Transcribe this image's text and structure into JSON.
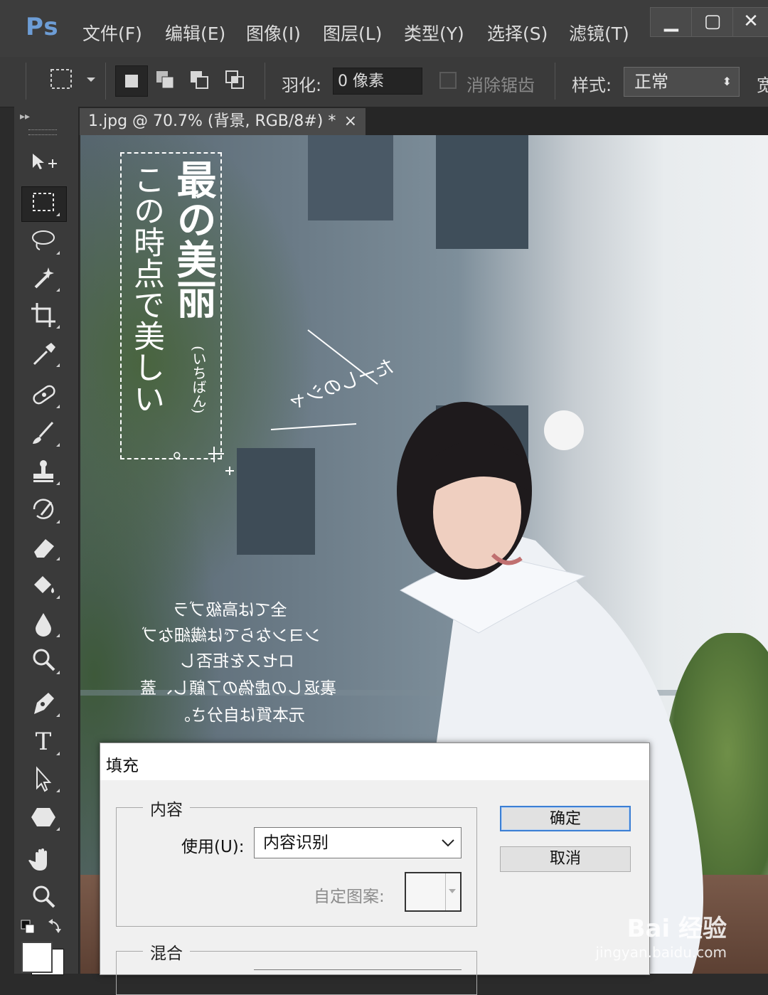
{
  "app": {
    "logo": "Ps",
    "menu": [
      "文件(F)",
      "编辑(E)",
      "图像(I)",
      "图层(L)",
      "类型(Y)",
      "选择(S)",
      "滤镜(T)"
    ],
    "window_buttons": [
      "▁",
      "▢",
      "✕"
    ]
  },
  "options": {
    "feather_label": "羽化:",
    "feather_value": "0 像素",
    "antialias_label": "消除锯齿",
    "style_label": "样式:",
    "style_value": "正常",
    "width_label_partial": "宽"
  },
  "document": {
    "tab_title": "1.jpg @ 70.7% (背景, RGB/8#) *",
    "tab_close": "×"
  },
  "canvas_text": {
    "headline": "最の美丽",
    "headline_small": "(いちばん)",
    "headline2": "この時点で美しい",
    "period": "。",
    "side_note": "たーしのシャ",
    "paragraph": [
      "全ては高級ブラ",
      "ンヨンならでは繊細なブ",
      "ロセスを拒否し",
      "裏返しの虚偽の了顧し、蓋",
      "元本質は自分さ。"
    ]
  },
  "dialog": {
    "title": "填充",
    "content_group": "内容",
    "use_label": "使用(U):",
    "use_value": "内容识别",
    "custom_pattern_label": "自定图案:",
    "blend_group": "混合",
    "ok_label": "确定",
    "cancel_label": "取消"
  },
  "watermark": {
    "brand": "Bai 经验",
    "url": "jingyan.baidu.com"
  }
}
